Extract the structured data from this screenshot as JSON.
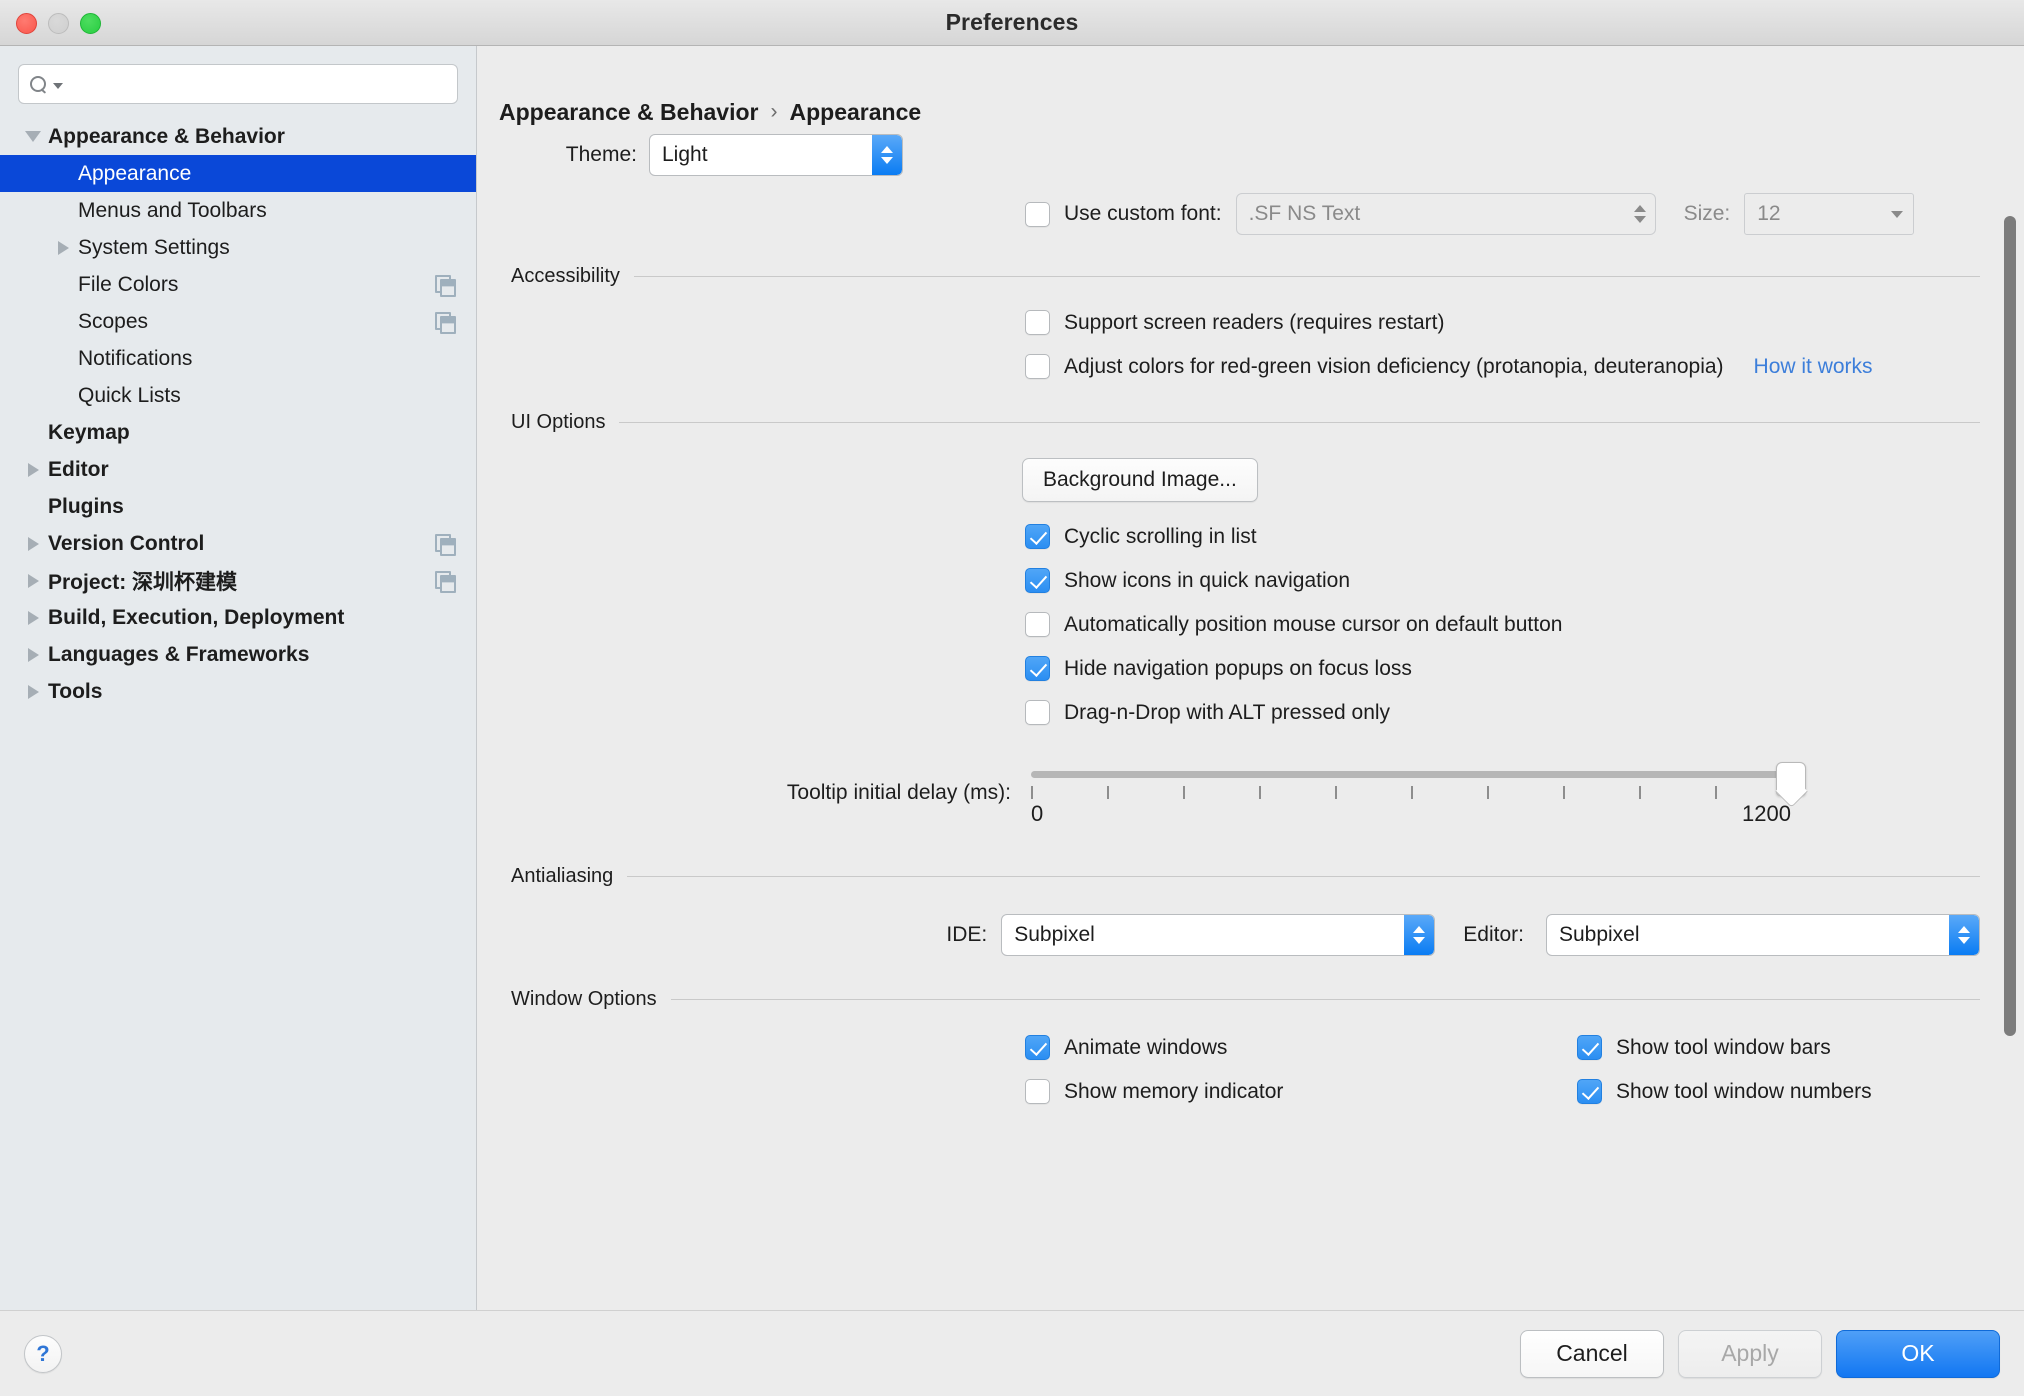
{
  "window": {
    "title": "Preferences"
  },
  "search": {
    "placeholder": "",
    "value": "",
    "icon": "search-icon"
  },
  "sidebar": {
    "items": [
      {
        "label": "Appearance & Behavior",
        "level": 0,
        "bold": true,
        "arrow": "open",
        "selected": false,
        "copy": false
      },
      {
        "label": "Appearance",
        "level": 1,
        "bold": false,
        "arrow": "none",
        "selected": true,
        "copy": false
      },
      {
        "label": "Menus and Toolbars",
        "level": 1,
        "bold": false,
        "arrow": "none",
        "selected": false,
        "copy": false
      },
      {
        "label": "System Settings",
        "level": 1,
        "bold": false,
        "arrow": "closed",
        "selected": false,
        "copy": false
      },
      {
        "label": "File Colors",
        "level": 1,
        "bold": false,
        "arrow": "none",
        "selected": false,
        "copy": true
      },
      {
        "label": "Scopes",
        "level": 1,
        "bold": false,
        "arrow": "none",
        "selected": false,
        "copy": true
      },
      {
        "label": "Notifications",
        "level": 1,
        "bold": false,
        "arrow": "none",
        "selected": false,
        "copy": false
      },
      {
        "label": "Quick Lists",
        "level": 1,
        "bold": false,
        "arrow": "none",
        "selected": false,
        "copy": false
      },
      {
        "label": "Keymap",
        "level": 0,
        "bold": true,
        "arrow": "none",
        "selected": false,
        "copy": false
      },
      {
        "label": "Editor",
        "level": 0,
        "bold": true,
        "arrow": "closed",
        "selected": false,
        "copy": false
      },
      {
        "label": "Plugins",
        "level": 0,
        "bold": true,
        "arrow": "none",
        "selected": false,
        "copy": false
      },
      {
        "label": "Version Control",
        "level": 0,
        "bold": true,
        "arrow": "closed",
        "selected": false,
        "copy": true
      },
      {
        "label": "Project: 深圳杯建模",
        "level": 0,
        "bold": true,
        "arrow": "closed",
        "selected": false,
        "copy": true
      },
      {
        "label": "Build, Execution, Deployment",
        "level": 0,
        "bold": true,
        "arrow": "closed",
        "selected": false,
        "copy": false
      },
      {
        "label": "Languages & Frameworks",
        "level": 0,
        "bold": true,
        "arrow": "closed",
        "selected": false,
        "copy": false
      },
      {
        "label": "Tools",
        "level": 0,
        "bold": true,
        "arrow": "closed",
        "selected": false,
        "copy": false
      }
    ]
  },
  "breadcrumb": {
    "root": "Appearance & Behavior",
    "separator": "›",
    "current": "Appearance"
  },
  "theme": {
    "label": "Theme:",
    "value": "Light"
  },
  "custom_font": {
    "checkbox_label": "Use custom font:",
    "checked": false,
    "font_value": ".SF NS Text",
    "size_label": "Size:",
    "size_value": "12"
  },
  "accessibility": {
    "title": "Accessibility",
    "options": [
      {
        "label": "Support screen readers (requires restart)",
        "checked": false
      },
      {
        "label": "Adjust colors for red-green vision deficiency (protanopia, deuteranopia)",
        "checked": false
      }
    ],
    "link": "How it works"
  },
  "ui_options": {
    "title": "UI Options",
    "background_image_button": "Background Image...",
    "options": [
      {
        "label": "Cyclic scrolling in list",
        "checked": true
      },
      {
        "label": "Show icons in quick navigation",
        "checked": true
      },
      {
        "label": "Automatically position mouse cursor on default button",
        "checked": false
      },
      {
        "label": "Hide navigation popups on focus loss",
        "checked": true
      },
      {
        "label": "Drag-n-Drop with ALT pressed only",
        "checked": false
      }
    ],
    "slider": {
      "label": "Tooltip initial delay (ms):",
      "min": "0",
      "max": "1200",
      "value": 1200,
      "ticks": 11
    }
  },
  "antialiasing": {
    "title": "Antialiasing",
    "ide_label": "IDE:",
    "ide_value": "Subpixel",
    "editor_label": "Editor:",
    "editor_value": "Subpixel"
  },
  "window_options": {
    "title": "Window Options",
    "left": [
      {
        "label": "Animate windows",
        "checked": true
      },
      {
        "label": "Show memory indicator",
        "checked": false
      }
    ],
    "right": [
      {
        "label": "Show tool window bars",
        "checked": true
      },
      {
        "label": "Show tool window numbers",
        "checked": true
      }
    ]
  },
  "footer": {
    "help": "?",
    "cancel": "Cancel",
    "apply": "Apply",
    "ok": "OK"
  },
  "colors": {
    "selection_blue": "#0a48d8",
    "accent_blue": "#2b8ef2",
    "link_blue": "#3c7eda",
    "sidebar_bg": "#e6eaed",
    "panel_bg": "#ececec"
  }
}
